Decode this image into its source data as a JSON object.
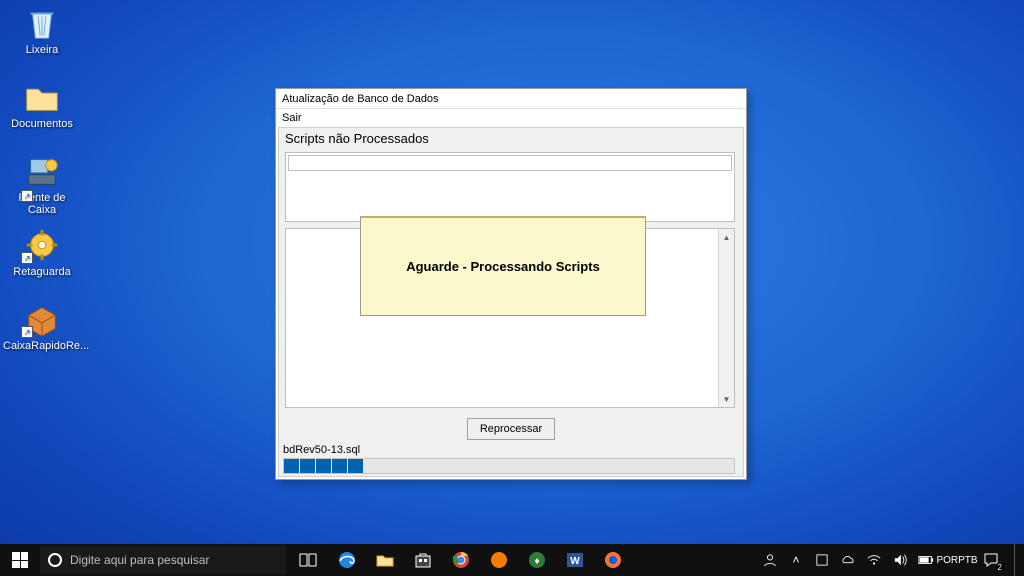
{
  "desktop": {
    "icons": [
      {
        "label": "Lixeira"
      },
      {
        "label": "Documentos"
      },
      {
        "label": "Frente de Caixa"
      },
      {
        "label": "Retaguarda"
      },
      {
        "label": "CaixaRapidoRe..."
      }
    ]
  },
  "app": {
    "title": "Atualização de Banco de Dados",
    "menu_exit": "Sair",
    "section_label": "Scripts não Processados",
    "reprocess_label": "Reprocessar",
    "current_file": "bdRev50-13.sql",
    "progress_segments": 5
  },
  "notice": {
    "text": "Aguarde - Processando Scripts"
  },
  "taskbar": {
    "search_placeholder": "Digite aqui para pesquisar",
    "lang_line1": "POR",
    "lang_line2": "PTB",
    "notification_count": "2"
  }
}
